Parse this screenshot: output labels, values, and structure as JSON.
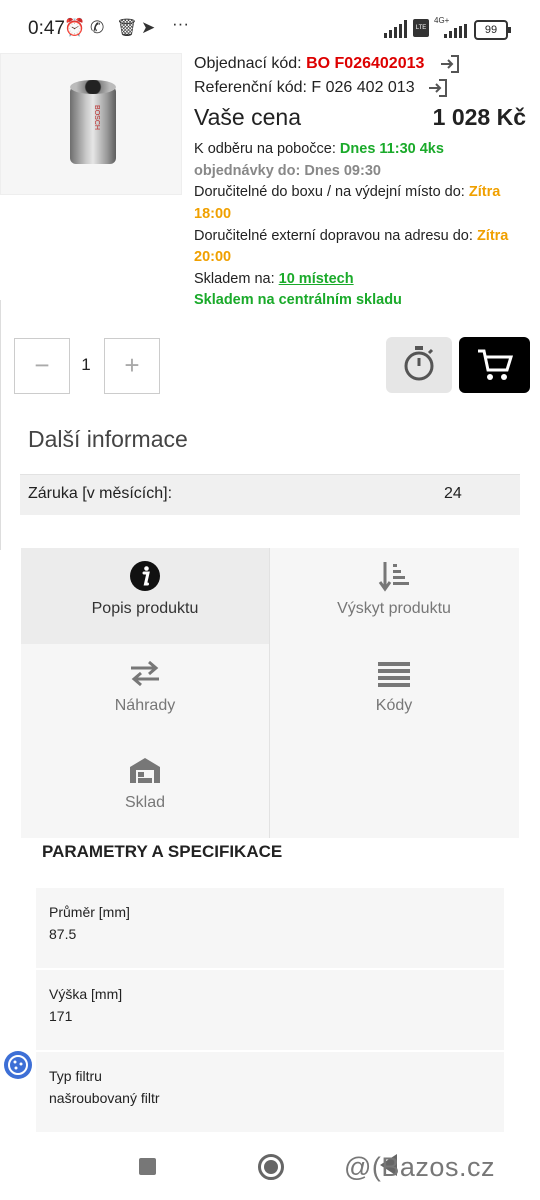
{
  "status_bar": {
    "time": "0:47",
    "network_top": "4G+",
    "network_bottom": "LTE",
    "battery": "99"
  },
  "product": {
    "order_code_label": "Objednací kód:",
    "order_code": "BO F026402013",
    "ref_code_label": "Referenční kód:",
    "ref_code": "F 026 402 013",
    "price_label": "Vaše cena",
    "price": "1 028 Kč",
    "pickup_label": "K odběru na pobočce:",
    "pickup_value": "Dnes 11:30 4ks",
    "order_deadline": "objednávky do: Dnes 09:30",
    "box_label": "Doručitelné do boxu / na výdejní místo do:",
    "box_value_1": "Zítra",
    "box_value_2": "18:00",
    "external_label": "Doručitelné externí dopravou na adresu do:",
    "external_value_1": "Zítra",
    "external_value_2": "20:00",
    "stock_label": "Skladem na:",
    "stock_value": "10 místech",
    "central_stock": "Skladem na centrálním skladu",
    "image_brand": "BOSCH"
  },
  "quantity": {
    "minus": "−",
    "value": "1",
    "plus": "+"
  },
  "more_info": {
    "title": "Další informace",
    "warranty_label": "Záruka [v měsících]:",
    "warranty_value": "24"
  },
  "tabs": [
    {
      "label": "Popis produktu",
      "icon": "info-icon",
      "active": true
    },
    {
      "label": "Výskyt produktu",
      "icon": "sort-icon",
      "active": false
    },
    {
      "label": "Náhrady",
      "icon": "swap-icon",
      "active": false
    },
    {
      "label": "Kódy",
      "icon": "list-icon",
      "active": false
    },
    {
      "label": "Sklad",
      "icon": "warehouse-icon",
      "active": false
    }
  ],
  "specs": {
    "title": "PARAMETRY A SPECIFIKACE",
    "rows": [
      {
        "name": "Průměr [mm]",
        "value": "87.5"
      },
      {
        "name": "Výška [mm]",
        "value": "171"
      },
      {
        "name": "Typ filtru",
        "value": "našroubovaný filtr"
      }
    ]
  },
  "watermark": "@(Bazos.cz",
  "colors": {
    "red": "#dd0000",
    "green": "#1aaa2a",
    "orange": "#f0a000",
    "cart_button": "#000000"
  }
}
